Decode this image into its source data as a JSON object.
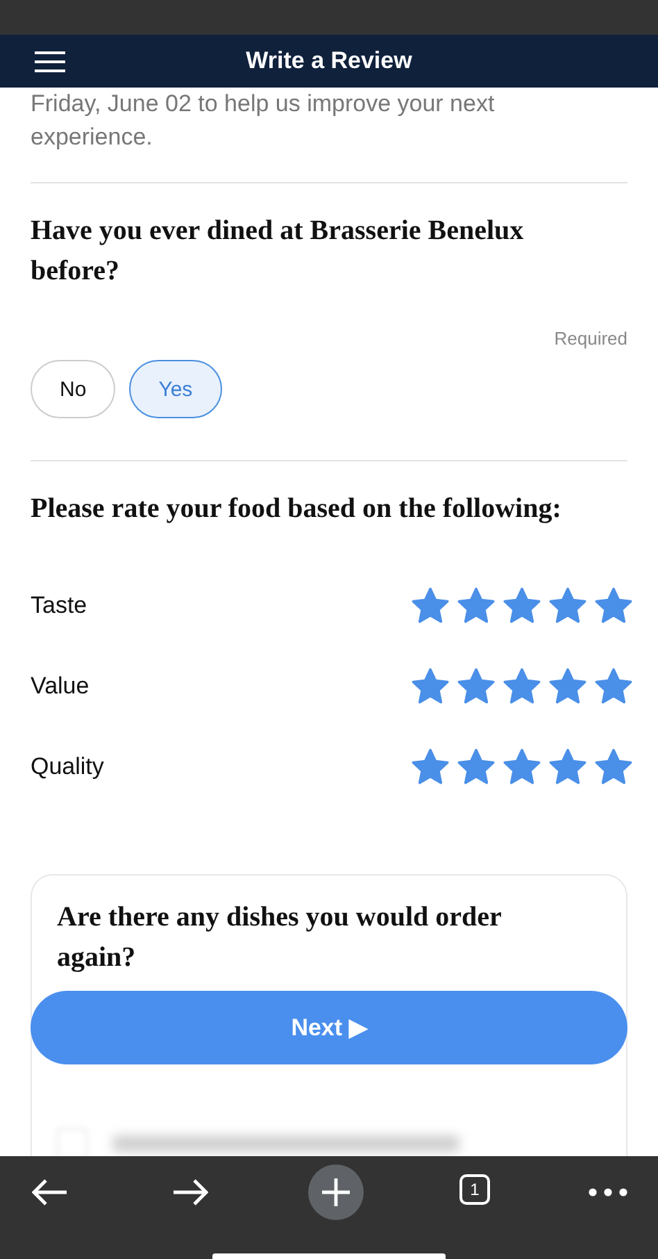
{
  "header": {
    "title": "Write a Review"
  },
  "intro": "Friday, June 02 to help us improve your next experience.",
  "visit_question": {
    "title": "Have you ever dined at Brasserie Benelux before?",
    "required": "Required",
    "options": [
      {
        "label": "No",
        "selected": false
      },
      {
        "label": "Yes",
        "selected": true
      }
    ]
  },
  "food_rating": {
    "title": "Please rate your food based on the following:",
    "items": [
      {
        "label": "Taste",
        "stars": 5
      },
      {
        "label": "Value",
        "stars": 5
      },
      {
        "label": "Quality",
        "stars": 5
      }
    ]
  },
  "dishes_question": {
    "title": "Are there any dishes you would order again?"
  },
  "next_button": "Next ▶",
  "browser_toolbar": {
    "tab_count": "1"
  }
}
